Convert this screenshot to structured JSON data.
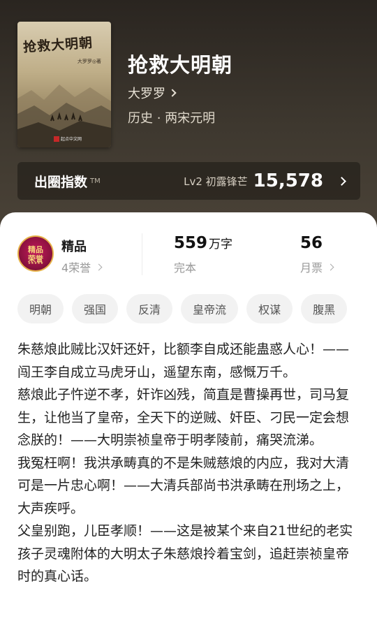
{
  "book": {
    "cover_title": "抢救大明朝",
    "cover_author": "大罗罗◎著",
    "cover_brand": "起点中文网",
    "title": "抢救大明朝",
    "author": "大罗罗",
    "genre": "历史 · 两宋元明"
  },
  "index": {
    "label": "出圈指数",
    "tm": "TM",
    "level": "Lv2 初露锋芒",
    "value": "15,578"
  },
  "stats": {
    "badge_line1": "精品",
    "badge_line2": "荣誉",
    "badge_stars": "★★★★★",
    "quality_label": "精品",
    "honors": "4荣誉",
    "words_num": "559",
    "words_unit": "万字",
    "words_status": "完本",
    "monthly_num": "56",
    "monthly_label": "月票"
  },
  "tags": [
    "明朝",
    "强国",
    "反清",
    "皇帝流",
    "权谋",
    "腹黑"
  ],
  "synopsis": [
    "朱慈烺此贼比汉奸还奸，比额李自成还能蛊惑人心！——闯王李自成立马虎牙山，遥望东南，感慨万千。",
    "慈烺此子忤逆不孝，奸诈凶残，简直是曹操再世，司马复生，让他当了皇帝，全天下的逆贼、奸臣、刁民一定会想念朕的！——大明崇祯皇帝于明孝陵前，痛哭流涕。",
    "我冤枉啊！我洪承畴真的不是朱贼慈烺的内应，我对大清可是一片忠心啊！——大清兵部尚书洪承畴在刑场之上，大声疾呼。",
    "父皇别跑，儿臣孝顺！——这是被某个来自21世纪的老实孩子灵魂附体的大明太子朱慈烺拎着宝剑，追赶崇祯皇帝时的真心话。"
  ]
}
